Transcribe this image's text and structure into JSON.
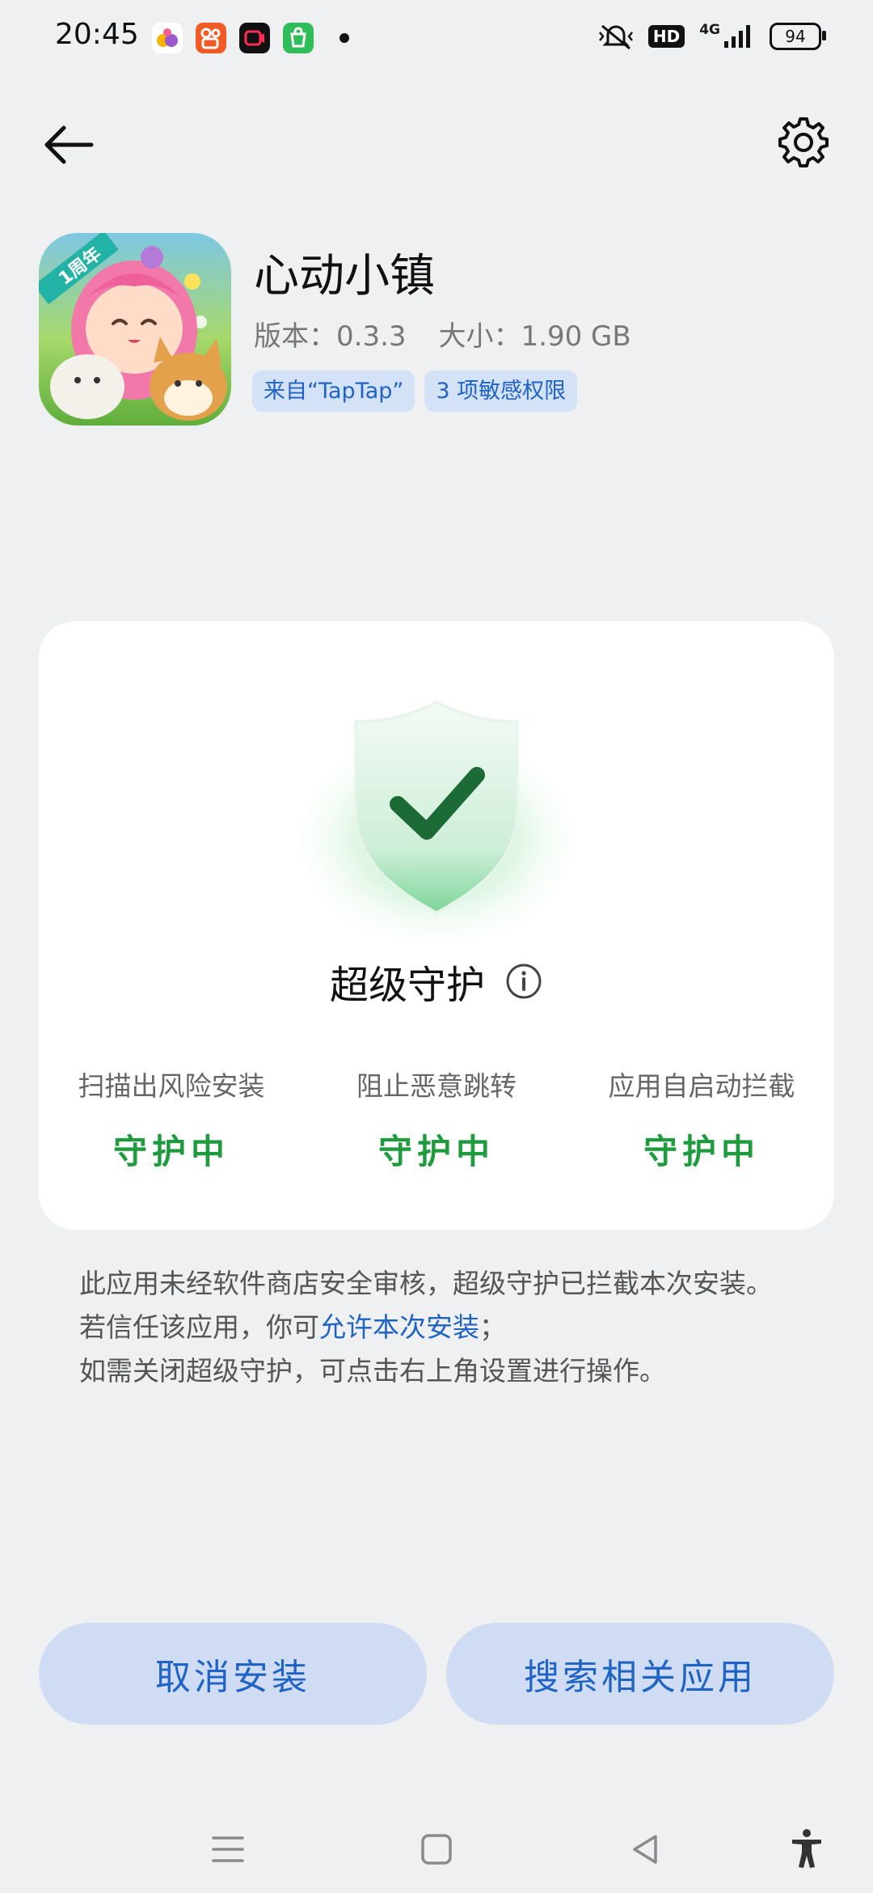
{
  "status_bar": {
    "time": "20:45",
    "app_icons": [
      "fruit-app-icon",
      "kuaishou-icon",
      "recorder-icon",
      "shop-icon"
    ],
    "hd": "HD",
    "network": "4G",
    "battery": "94"
  },
  "toolbar": {
    "back_icon": "back-arrow-icon",
    "settings_icon": "gear-icon"
  },
  "app": {
    "name": "心动小镇",
    "version": "版本：0.3.3",
    "size": "大小：1.90 GB",
    "tags": [
      "来自“TapTap”",
      "3 项敏感权限"
    ],
    "icon_badge": "1周年"
  },
  "protection": {
    "title": "超级守护",
    "features": [
      {
        "label": "扫描出风险安装",
        "status": "守护中"
      },
      {
        "label": "阻止恶意跳转",
        "status": "守护中"
      },
      {
        "label": "应用自启动拦截",
        "status": "守护中"
      }
    ]
  },
  "notice": {
    "text_before_link": "此应用未经软件商店安全审核，超级守护已拦截本次安装。若信任该应用，你可",
    "link": "允许本次安装",
    "text_after_link": "；",
    "line2": "如需关闭超级守护，可点击右上角设置进行操作。"
  },
  "buttons": {
    "cancel": "取消安装",
    "search": "搜索相关应用"
  },
  "colors": {
    "accent_blue": "#1f63c4",
    "button_bg": "#cfdcf4",
    "green_status": "#1e9b3d",
    "page_bg": "#eff0f2"
  }
}
